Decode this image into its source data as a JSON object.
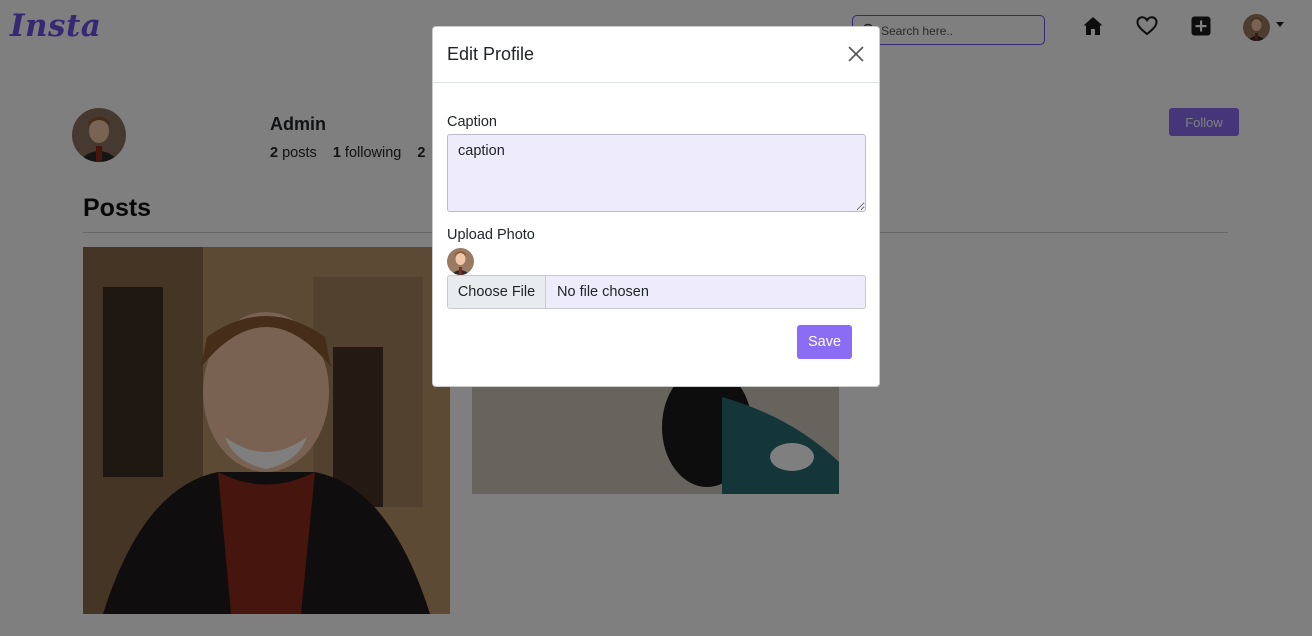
{
  "navbar": {
    "brand": "Insta",
    "search_placeholder": "Search here..",
    "icons": [
      "home-icon",
      "heart-icon",
      "add-icon"
    ],
    "accent": "#6f50e8"
  },
  "profile": {
    "name": "Admin",
    "posts_count": "2",
    "posts_label": "posts",
    "following_count": "1",
    "following_label": "following",
    "followers_count": "2",
    "follow_label": "Follow"
  },
  "posts_section": {
    "title": "Posts"
  },
  "modal": {
    "title": "Edit Profile",
    "caption_label": "Caption",
    "caption_value": "caption",
    "upload_label": "Upload Photo",
    "file_button_label": "Choose File",
    "file_status": "No file chosen",
    "save_label": "Save",
    "button_color": "#8a6cf5"
  }
}
